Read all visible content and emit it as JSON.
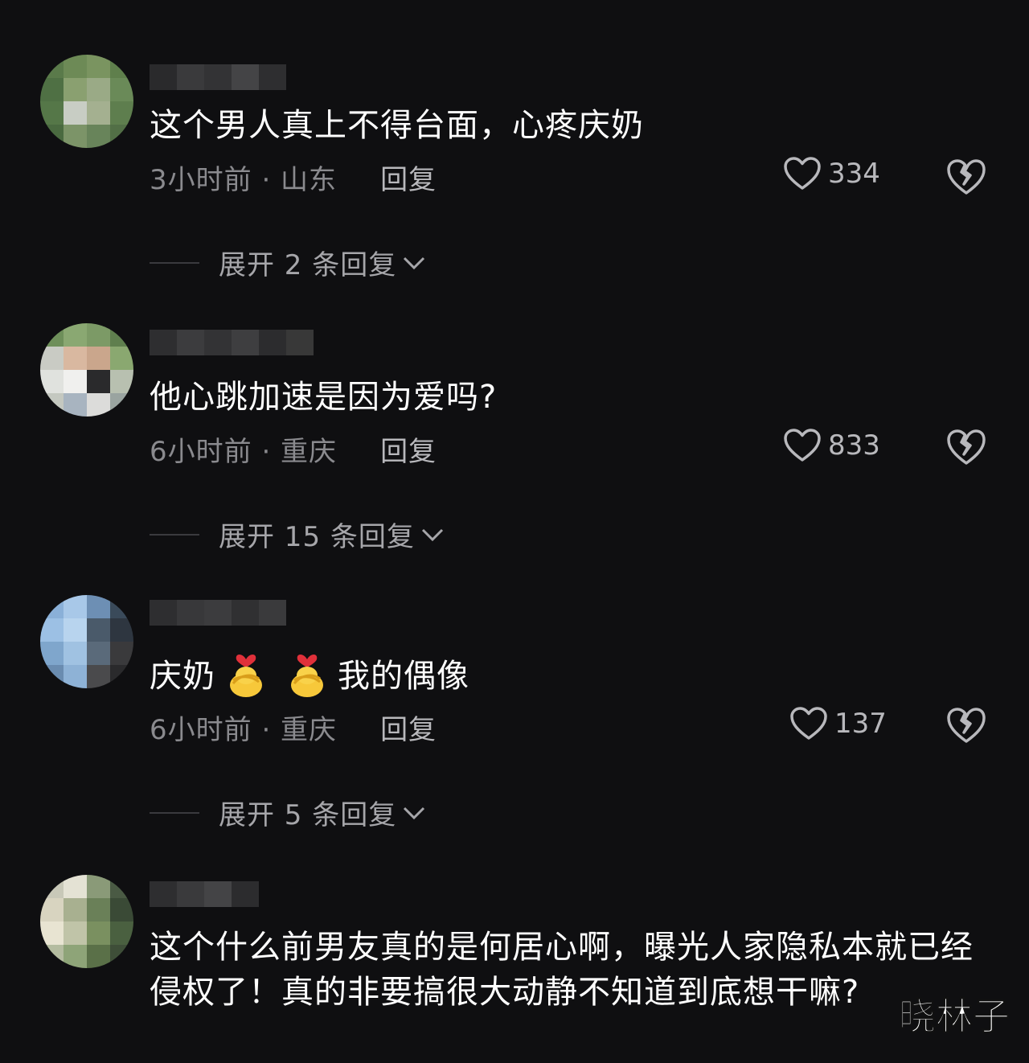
{
  "comments": [
    {
      "text": "这个男人真上不得台面，心疼庆奶",
      "time_location": "3小时前 · 山东",
      "reply_label": "回复",
      "likes": "334",
      "expand_label": "展开 2 条回复"
    },
    {
      "text": "他心跳加速是因为爱吗?",
      "time_location": "6小时前 · 重庆",
      "reply_label": "回复",
      "likes": "833",
      "expand_label": "展开 15 条回复"
    },
    {
      "text_before": "庆奶",
      "text_after": "我的偶像",
      "time_location": "6小时前 · 重庆",
      "reply_label": "回复",
      "likes": "137",
      "expand_label": "展开 5 条回复"
    },
    {
      "text": "这个什么前男友真的是何居心啊，曝光人家隐私本就已经侵权了！真的非要搞很大动静不知道到底想干嘛?"
    }
  ],
  "watermark": "晓林子",
  "colors": {
    "background": "#0f0f11",
    "text": "#ffffff",
    "meta": "#8a8a8e",
    "icon": "#b8b8bc"
  },
  "icons": [
    "heart-outline-icon",
    "broken-heart-icon",
    "chevron-down-icon",
    "hug-emoji-icon"
  ]
}
